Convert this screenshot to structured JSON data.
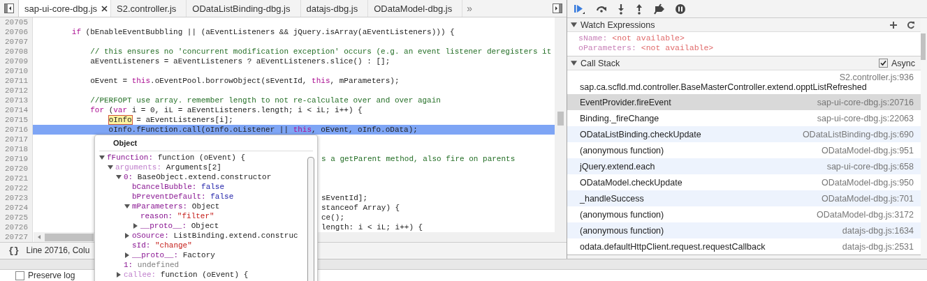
{
  "tab_bar": {
    "tabs": [
      {
        "label": "sap-ui-core-dbg.js",
        "selected": true
      },
      {
        "label": "S2.controller.js",
        "selected": false
      },
      {
        "label": "ODataListBinding-dbg.js",
        "selected": false
      },
      {
        "label": "datajs-dbg.js",
        "selected": false
      },
      {
        "label": "ODataModel-dbg.js",
        "selected": false
      }
    ],
    "overflow": "»"
  },
  "editor": {
    "lines": [
      {
        "number": "20705",
        "kind": "full",
        "current": false
      },
      {
        "number": "20706",
        "kind": "full",
        "current": false,
        "tokens": [
          {
            "kind": "keyword",
            "text": "        if"
          },
          {
            "kind": "plain",
            "text": " (bEnableEventBubbling || (aEventListeners && jQuery.isArray(aEventListeners))) {"
          }
        ]
      },
      {
        "number": "20707",
        "kind": "full",
        "current": false
      },
      {
        "number": "20708",
        "kind": "full",
        "current": false,
        "tokens": [
          {
            "kind": "comment",
            "text": "            // this ensures no 'concurrent modification exception' occurs (e.g. an event listener deregisters it"
          }
        ]
      },
      {
        "number": "20709",
        "kind": "full",
        "current": false,
        "tokens": [
          {
            "kind": "plain",
            "text": "            aEventListeners = aEventListeners ? aEventListeners.slice() : [];"
          }
        ]
      },
      {
        "number": "20710",
        "kind": "full",
        "current": false
      },
      {
        "number": "20711",
        "kind": "full",
        "current": false,
        "tokens": [
          {
            "kind": "plain",
            "text": "            oEvent = "
          },
          {
            "kind": "keyword",
            "text": "this"
          },
          {
            "kind": "plain",
            "text": ".oEventPool.borrowObject(sEventId, "
          },
          {
            "kind": "keyword",
            "text": "this"
          },
          {
            "kind": "plain",
            "text": ", mParameters);"
          }
        ]
      },
      {
        "number": "20712",
        "kind": "full",
        "current": false
      },
      {
        "number": "20713",
        "kind": "full",
        "current": false,
        "tokens": [
          {
            "kind": "comment",
            "text": "            //PERFOPT use array. remember length to not re-calculate over and over again"
          }
        ]
      },
      {
        "number": "20714",
        "kind": "full",
        "current": false,
        "tokens": [
          {
            "kind": "keyword",
            "text": "            for"
          },
          {
            "kind": "plain",
            "text": " ("
          },
          {
            "kind": "keyword",
            "text": "var"
          },
          {
            "kind": "plain",
            "text": " i = 0, iL = aEventListeners.length; i < iL; i++) {"
          }
        ]
      },
      {
        "number": "20715",
        "kind": "full",
        "current": false,
        "tokens": [
          {
            "kind": "marked",
            "text": "                oInfo"
          },
          {
            "kind": "plain",
            "text": " = aEventListeners[i];"
          }
        ]
      },
      {
        "number": "20716",
        "kind": "full",
        "current": true,
        "tokens": [
          {
            "kind": "plain",
            "text": "                oInfo.fFunction.call(oInfo.oListener || "
          },
          {
            "kind": "keyword",
            "text": "this"
          },
          {
            "kind": "plain",
            "text": ", oEvent, oInfo.oData);"
          }
        ]
      },
      {
        "number": "20717",
        "kind": "full",
        "current": false
      },
      {
        "number": "20718",
        "kind": "full",
        "current": false
      },
      {
        "number": "20719",
        "kind": "covered",
        "current": false,
        "tokens": [
          {
            "kind": "comment",
            "text": "s a getParent method, also fire on parents"
          }
        ]
      },
      {
        "number": "20720",
        "kind": "full",
        "current": false
      },
      {
        "number": "20721",
        "kind": "full",
        "current": false
      },
      {
        "number": "20722",
        "kind": "full",
        "current": false
      },
      {
        "number": "20723",
        "kind": "covered",
        "current": false,
        "tokens": [
          {
            "kind": "plain",
            "text": "sEventId];"
          }
        ]
      },
      {
        "number": "20724",
        "kind": "covered",
        "current": false,
        "tokens": [
          {
            "kind": "plain",
            "text": "stanceof Array) {"
          }
        ]
      },
      {
        "number": "20725",
        "kind": "covered",
        "current": false,
        "tokens": [
          {
            "kind": "plain",
            "text": "ce();"
          }
        ]
      },
      {
        "number": "20726",
        "kind": "covered",
        "current": false,
        "tokens": [
          {
            "kind": "plain",
            "text": "length: i < iL; i++) {"
          }
        ]
      },
      {
        "number": "20727",
        "kind": "full",
        "current": false
      }
    ],
    "status": {
      "pretty_print": "{}",
      "position": "Line 20716, Colu"
    }
  },
  "popover": {
    "title": "Object",
    "tree": [
      {
        "key": "fFunction:",
        "value": "function (oEvent) {",
        "kind": "plain",
        "faded": false,
        "expanded": true,
        "children": [
          {
            "key": "arguments:",
            "value": "Arguments[2]",
            "kind": "plain",
            "faded": true,
            "expanded": true,
            "children": [
              {
                "key": "0:",
                "value": "BaseObject.extend.constructor",
                "kind": "plain",
                "faded": false,
                "expanded": true,
                "children": [
                  {
                    "key": "bCancelBubble:",
                    "value": "false",
                    "kind": "keyword",
                    "faded": false
                  },
                  {
                    "key": "bPreventDefault:",
                    "value": "false",
                    "kind": "keyword",
                    "faded": false
                  },
                  {
                    "key": "mParameters:",
                    "value": "Object",
                    "kind": "plain",
                    "faded": false,
                    "expanded": true,
                    "children": [
                      {
                        "key": "reason:",
                        "value": "\"filter\"",
                        "kind": "string",
                        "faded": false
                      },
                      {
                        "key": "__proto__:",
                        "value": "Object",
                        "kind": "plain",
                        "faded": false,
                        "expanded": false
                      }
                    ]
                  },
                  {
                    "key": "oSource:",
                    "value": "ListBinding.extend.construc",
                    "kind": "plain",
                    "faded": false,
                    "expanded": false
                  },
                  {
                    "key": "sId:",
                    "value": "\"change\"",
                    "kind": "string",
                    "faded": false
                  },
                  {
                    "key": "__proto__:",
                    "value": "Factory",
                    "kind": "plain",
                    "faded": false,
                    "expanded": false
                  }
                ]
              },
              {
                "key": "1:",
                "value": "undefined",
                "kind": "undefined",
                "faded": false
              },
              {
                "key": "callee:",
                "value": "function (oEvent) {",
                "kind": "plain",
                "faded": true,
                "expanded": false
              }
            ]
          }
        ]
      }
    ]
  },
  "drawer": {
    "preserve_log": {
      "label": "Preserve log",
      "checked": false
    }
  },
  "debugger": {
    "watch_expressions": {
      "title": "Watch Expressions",
      "expanded": true,
      "items": [
        {
          "name": "sName:",
          "value": "<not available>"
        },
        {
          "name": "oParameters:",
          "value": "<not available>"
        }
      ]
    },
    "call_stack": {
      "title": "Call Stack",
      "expanded": true,
      "async": {
        "label": "Async",
        "checked": true
      },
      "frames": [
        {
          "function": "sap.ca.scfld.md.controller.BaseMasterController.extend.opptListRefreshed",
          "location": "S2.controller.js:936",
          "selected": false,
          "shaded": false
        },
        {
          "function": "EventProvider.fireEvent",
          "location": "sap-ui-core-dbg.js:20716",
          "selected": true,
          "shaded": false
        },
        {
          "function": "Binding._fireChange",
          "location": "sap-ui-core-dbg.js:22063",
          "selected": false,
          "shaded": false
        },
        {
          "function": "ODataListBinding.checkUpdate",
          "location": "ODataListBinding-dbg.js:690",
          "selected": false,
          "shaded": true
        },
        {
          "function": "(anonymous function)",
          "location": "ODataModel-dbg.js:951",
          "selected": false,
          "shaded": false
        },
        {
          "function": "jQuery.extend.each",
          "location": "sap-ui-core-dbg.js:658",
          "selected": false,
          "shaded": true
        },
        {
          "function": "ODataModel.checkUpdate",
          "location": "ODataModel-dbg.js:950",
          "selected": false,
          "shaded": false
        },
        {
          "function": "_handleSuccess",
          "location": "ODataModel-dbg.js:701",
          "selected": false,
          "shaded": true
        },
        {
          "function": "(anonymous function)",
          "location": "ODataModel-dbg.js:3172",
          "selected": false,
          "shaded": false
        },
        {
          "function": "(anonymous function)",
          "location": "datajs-dbg.js:1634",
          "selected": false,
          "shaded": true
        },
        {
          "function": "odata.defaultHttpClient.request.requestCallback",
          "location": "datajs-dbg.js:2531",
          "selected": false,
          "shaded": false
        }
      ]
    }
  }
}
